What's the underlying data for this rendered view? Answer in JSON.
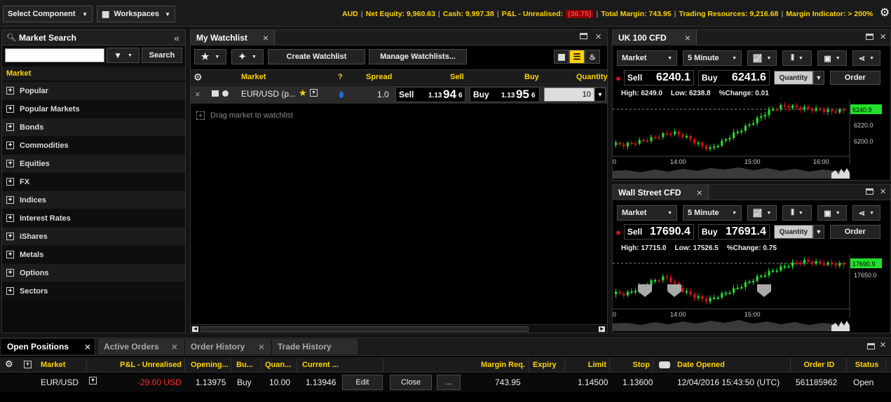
{
  "topbar": {
    "select_component": "Select Component",
    "workspaces": "Workspaces",
    "currency": "AUD",
    "net_equity": "Net Equity: 9,960.63",
    "cash": "Cash: 9,997.38",
    "pl_label": "P&L - Unrealised:",
    "pl_value": "(36.75)",
    "total_margin": "Total Margin: 743.95",
    "trading_resources": "Trading Resources: 9,216.68",
    "margin_indicator": "Margin Indicator:  > 200%"
  },
  "market_search": {
    "title": "Market Search",
    "search_button": "Search",
    "header": "Market",
    "categories": [
      "Popular",
      "Popular Markets",
      "Bonds",
      "Commodities",
      "Equities",
      "FX",
      "Indices",
      "Interest Rates",
      "iShares",
      "Metals",
      "Options",
      "Sectors"
    ]
  },
  "watchlist": {
    "title": "My Watchlist",
    "create_button": "Create Watchlist",
    "manage_button": "Manage Watchlists...",
    "columns": {
      "market": "Market",
      "question": "?",
      "spread": "Spread",
      "sell": "Sell",
      "buy": "Buy",
      "quantity": "Quantity"
    },
    "row": {
      "market": "EUR/USD (p...",
      "spread": "1.0",
      "sell_label": "Sell",
      "sell_small": "1.13",
      "sell_big": "94",
      "sell_pip": "6",
      "buy_label": "Buy",
      "buy_small": "1.13",
      "buy_big": "95",
      "buy_pip": "6",
      "quantity": "10"
    },
    "drag_hint": "Drag market to watchlist"
  },
  "chart1": {
    "title": "UK 100 CFD",
    "type_select": "Market",
    "interval": "5 Minute",
    "sell_label": "Sell",
    "sell_price": "6240.1",
    "buy_label": "Buy",
    "buy_price": "6241.6",
    "quantity": "Quantity",
    "order": "Order",
    "high": "High: 6249.0",
    "low": "Low:  6238.8",
    "change": "%Change: 0.01",
    "price_tag": "6240.9",
    "y_labels": [
      "6220.0",
      "6200.0"
    ],
    "x_labels": [
      "14:00",
      "15:00",
      "16:00"
    ]
  },
  "chart2": {
    "title": "Wall Street CFD",
    "type_select": "Market",
    "interval": "5 Minute",
    "sell_label": "Sell",
    "sell_price": "17690.4",
    "buy_label": "Buy",
    "buy_price": "17691.4",
    "quantity": "Quantity",
    "order": "Order",
    "high": "High: 17715.0",
    "low": "Low:  17526.5",
    "change": "%Change: 0.75",
    "price_tag": "17690.9",
    "y_labels": [
      "17650.0"
    ],
    "x_labels": [
      "14:00",
      "15:00"
    ]
  },
  "bottom": {
    "tabs": [
      "Open Positions",
      "Active Orders",
      "Order History",
      "Trade History"
    ],
    "columns": {
      "market": "Market",
      "pl": "P&L - Unrealised",
      "opening": "Opening...",
      "buy": "Bu...",
      "quantity": "Quan...",
      "current": "Current ...",
      "margin": "Margin Req.",
      "expiry": "Expiry",
      "limit": "Limit",
      "stop": "Stop",
      "date_opened": "Date Opened",
      "order_id": "Order ID",
      "status": "Status"
    },
    "row": {
      "market": "EUR/USD",
      "pl": "-29.00 USD",
      "opening": "1.13975",
      "direction": "Buy",
      "quantity": "10.00",
      "current": "1.13946",
      "edit": "Edit",
      "close": "Close",
      "more": "...",
      "margin": "743.95",
      "limit": "1.14500",
      "stop": "1.13600",
      "date_opened": "12/04/2016 15:43:50 (UTC)",
      "order_id": "561185962",
      "status": "Open"
    }
  },
  "colors": {
    "accent": "#ffd200",
    "up": "#22e02a",
    "down": "#e01010",
    "loss": "#ff2a2a"
  }
}
